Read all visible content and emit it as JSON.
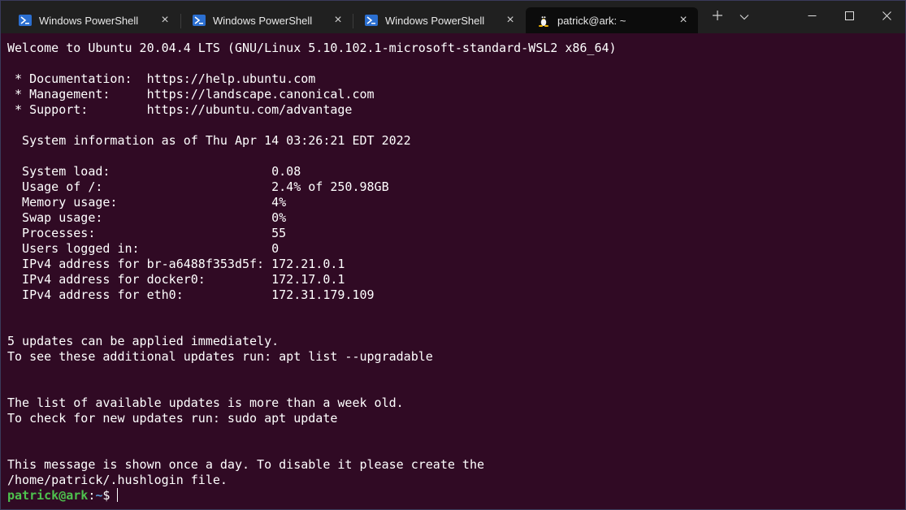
{
  "tabs": [
    {
      "title": "Windows PowerShell",
      "icon": "powershell-icon",
      "active": false
    },
    {
      "title": "Windows PowerShell",
      "icon": "powershell-icon",
      "active": false
    },
    {
      "title": "Windows PowerShell",
      "icon": "powershell-icon",
      "active": false
    },
    {
      "title": "patrick@ark: ~",
      "icon": "linux-tux-icon",
      "active": true
    }
  ],
  "titlebar": {
    "new_tab_icon": "plus-icon",
    "dropdown_icon": "chevron-down-icon",
    "window_controls": [
      "minimize-icon",
      "maximize-icon",
      "close-icon"
    ]
  },
  "terminal": {
    "lines": [
      "Welcome to Ubuntu 20.04.4 LTS (GNU/Linux 5.10.102.1-microsoft-standard-WSL2 x86_64)",
      "",
      " * Documentation:  https://help.ubuntu.com",
      " * Management:     https://landscape.canonical.com",
      " * Support:        https://ubuntu.com/advantage",
      "",
      "  System information as of Thu Apr 14 03:26:21 EDT 2022",
      "",
      "  System load:                      0.08",
      "  Usage of /:                       2.4% of 250.98GB",
      "  Memory usage:                     4%",
      "  Swap usage:                       0%",
      "  Processes:                        55",
      "  Users logged in:                  0",
      "  IPv4 address for br-a6488f353d5f: 172.21.0.1",
      "  IPv4 address for docker0:         172.17.0.1",
      "  IPv4 address for eth0:            172.31.179.109",
      "",
      "",
      "5 updates can be applied immediately.",
      "To see these additional updates run: apt list --upgradable",
      "",
      "",
      "The list of available updates is more than a week old.",
      "To check for new updates run: sudo apt update",
      "",
      "",
      "This message is shown once a day. To disable it please create the",
      "/home/patrick/.hushlogin file."
    ],
    "prompt": {
      "user_host": "patrick@ark",
      "separator": ":",
      "path": "~",
      "symbol": "$"
    }
  },
  "colors": {
    "terminal_bg": "#300a24",
    "titlebar_bg": "#202020",
    "active_tab_bg": "#0c0c0c",
    "prompt_user": "#4ec24e",
    "prompt_path": "#5a9ad6"
  }
}
